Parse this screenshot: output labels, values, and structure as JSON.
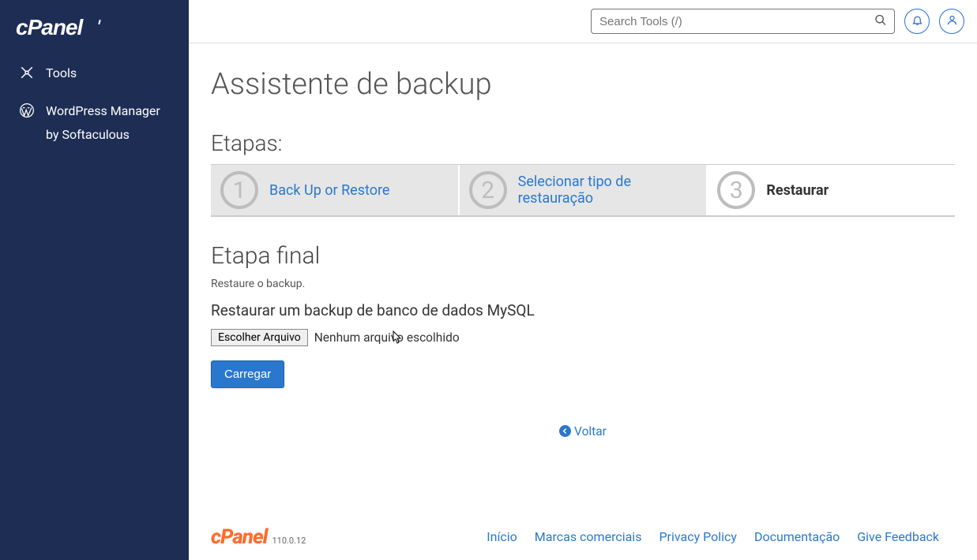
{
  "sidebar": {
    "items": [
      {
        "label": "Tools"
      },
      {
        "label": "WordPress Manager by Softaculous"
      }
    ]
  },
  "header": {
    "search_placeholder": "Search Tools (/)"
  },
  "page": {
    "title": "Assistente de backup",
    "steps_heading": "Etapas:",
    "steps": [
      {
        "num": "1",
        "label": "Back Up or Restore"
      },
      {
        "num": "2",
        "label": "Selecionar tipo de restauração"
      },
      {
        "num": "3",
        "label": "Restaurar"
      }
    ],
    "final_heading": "Etapa final",
    "final_hint": "Restaure o backup.",
    "restore_subtitle": "Restaurar um backup de banco de dados MySQL",
    "choose_file_label": "Escolher Arquivo",
    "no_file_text": "Nenhum arquivo escolhido",
    "upload_label": "Carregar",
    "back_label": "Voltar"
  },
  "footer": {
    "version": "110.0.12",
    "links": [
      "Início",
      "Marcas comerciais",
      "Privacy Policy",
      "Documentação",
      "Give Feedback"
    ]
  }
}
